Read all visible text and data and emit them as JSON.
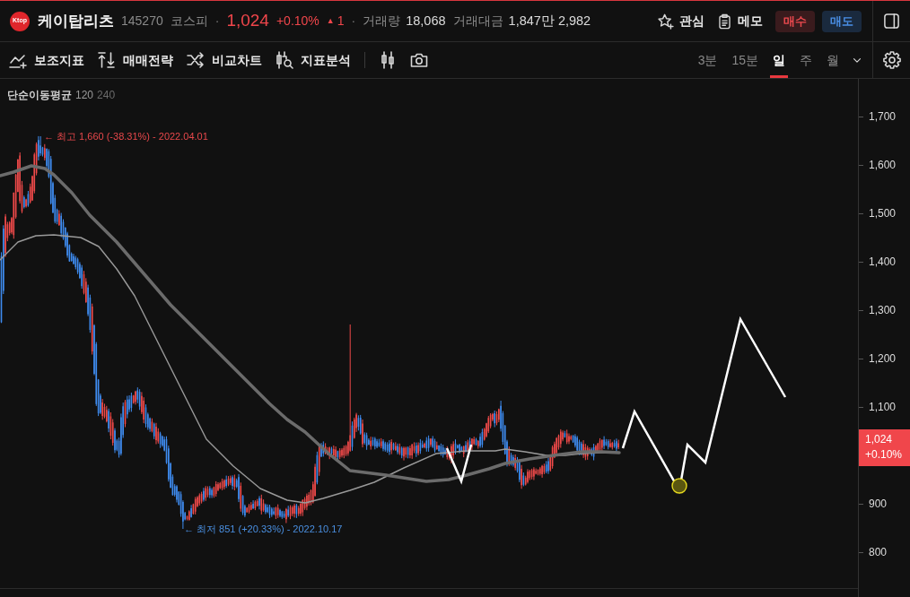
{
  "header": {
    "logo_text": "Ktop",
    "name": "케이탑리츠",
    "rising": true,
    "items": [
      {
        "kind": "code",
        "text": "145270"
      },
      {
        "kind": "market",
        "text": "코스피"
      },
      {
        "kind": "dot",
        "text": "·"
      },
      {
        "kind": "price",
        "text": "1,024"
      },
      {
        "kind": "change_pct",
        "text": "+0.10%"
      },
      {
        "kind": "arrow",
        "text": "▲"
      },
      {
        "kind": "change",
        "text": "1"
      },
      {
        "kind": "dot",
        "text": "·"
      },
      {
        "kind": "stat_label",
        "text": "거래량"
      },
      {
        "kind": "stat_value",
        "text": "18,068"
      },
      {
        "kind": "stat_label",
        "text": "거래대금"
      },
      {
        "kind": "stat_value",
        "text": "1,847만 2,982"
      }
    ]
  },
  "actions": [
    {
      "kind": "watch",
      "label": "관심"
    },
    {
      "kind": "memo",
      "label": "메모"
    },
    {
      "kind": "buy",
      "label": "매수"
    },
    {
      "kind": "sell",
      "label": "매도"
    }
  ],
  "toolbar": {
    "tools": [
      {
        "kind": "indicators",
        "label": "보조지표"
      },
      {
        "kind": "strategy",
        "label": "매매전략"
      },
      {
        "kind": "compare",
        "label": "비교차트"
      },
      {
        "kind": "analysis",
        "label": "지표분석"
      },
      {
        "kind": "chart_type"
      },
      {
        "kind": "snapshot"
      }
    ],
    "intervals": [
      {
        "label": "3분",
        "selected": false
      },
      {
        "label": "15분",
        "selected": false
      },
      {
        "label": "일",
        "selected": true
      },
      {
        "label": "주",
        "selected": false
      },
      {
        "label": "월",
        "selected": false
      }
    ]
  },
  "chart": {
    "legend": {
      "title": "단순이동평균",
      "series": [
        {
          "label": "120",
          "color": "#9a9a9a"
        },
        {
          "label": "240",
          "color": "#6b6b6b"
        }
      ]
    },
    "high_note": "← 최고 1,660 (-38.31%) - 2022.04.01",
    "low_note": "← 최저 851 (+20.33%) - 2022.10.17",
    "price_axis": [
      {
        "kind": "tick",
        "label": "1,700"
      },
      {
        "kind": "tick",
        "label": "1,600"
      },
      {
        "kind": "tick",
        "label": "1,500"
      },
      {
        "kind": "tick",
        "label": "1,400"
      },
      {
        "kind": "tick",
        "label": "1,300"
      },
      {
        "kind": "tick",
        "label": "1,200"
      },
      {
        "kind": "tick",
        "label": "1,100"
      },
      {
        "kind": "current",
        "price": "1,024",
        "change": "+0.10%"
      },
      {
        "kind": "tick",
        "label": "900"
      },
      {
        "kind": "tick",
        "label": "800"
      }
    ]
  }
}
